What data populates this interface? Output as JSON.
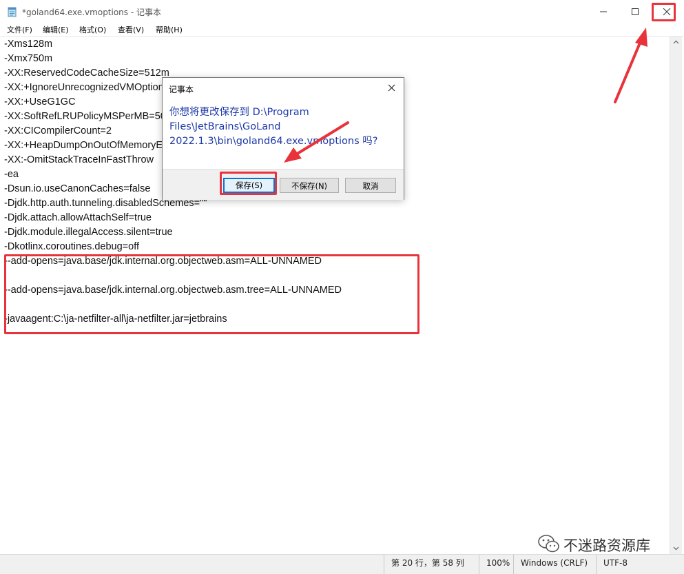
{
  "window": {
    "title": "*goland64.exe.vmoptions - 记事本",
    "icon": "notepad-icon"
  },
  "menu": [
    "文件(F)",
    "编辑(E)",
    "格式(O)",
    "查看(V)",
    "帮助(H)"
  ],
  "editor": {
    "lines": [
      "-Xms128m",
      "-Xmx750m",
      "-XX:ReservedCodeCacheSize=512m",
      "-XX:+IgnoreUnrecognizedVMOptions",
      "-XX:+UseG1GC",
      "-XX:SoftRefLRUPolicyMSPerMB=50",
      "-XX:CICompilerCount=2",
      "-XX:+HeapDumpOnOutOfMemoryError",
      "-XX:-OmitStackTraceInFastThrow",
      "-ea",
      "-Dsun.io.useCanonCaches=false",
      "-Djdk.http.auth.tunneling.disabledSchemes=\"\"",
      "-Djdk.attach.allowAttachSelf=true",
      "-Djdk.module.illegalAccess.silent=true",
      "-Dkotlinx.coroutines.debug=off",
      "--add-opens=java.base/jdk.internal.org.objectweb.asm=ALL-UNNAMED",
      "",
      "--add-opens=java.base/jdk.internal.org.objectweb.asm.tree=ALL-UNNAMED",
      "",
      "-javaagent:C:\\ja-netfilter-all\\ja-netfilter.jar=jetbrains"
    ]
  },
  "dialog": {
    "title": "记事本",
    "message_lines": [
      "你想将更改保存到 D:\\Program",
      "Files\\JetBrains\\GoLand",
      "2022.1.3\\bin\\goland64.exe.vmoptions 吗?"
    ],
    "save_label": "保存(S)",
    "dont_save_label": "不保存(N)",
    "cancel_label": "取消"
  },
  "status": {
    "position": "第 20 行，第 58 列",
    "zoom": "100%",
    "line_ending": "Windows (CRLF)",
    "encoding": "UTF-8"
  },
  "watermark": {
    "text": "不迷路资源库"
  },
  "colors": {
    "highlight": "#e8333b",
    "dialog_text": "#1f3aa8",
    "focus": "#0078d7"
  }
}
